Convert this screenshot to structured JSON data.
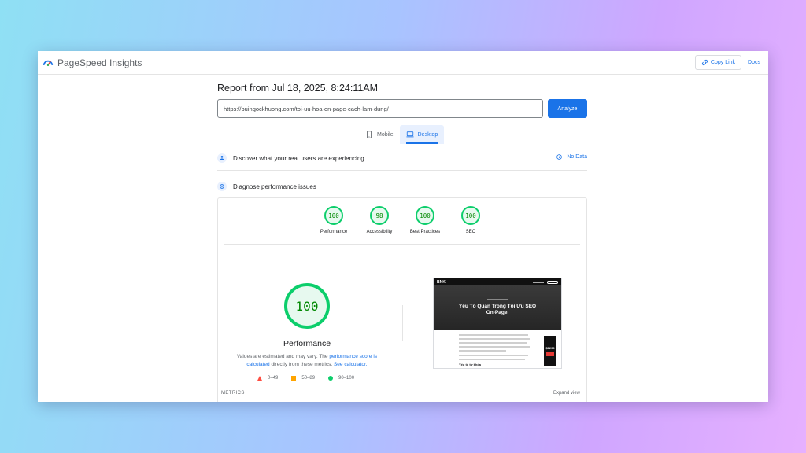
{
  "header": {
    "app_title": "PageSpeed Insights",
    "copy_link_label": "Copy Link",
    "docs_label": "Docs"
  },
  "report": {
    "title": "Report from Jul 18, 2025, 8:24:11AM",
    "url_value": "https://buingockhuong.com/toi-uu-hoa-on-page-cach-lam-dung/",
    "analyze_label": "Analyze"
  },
  "tabs": [
    {
      "label": "Mobile",
      "icon": "mobile-icon",
      "active": false
    },
    {
      "label": "Desktop",
      "icon": "desktop-icon",
      "active": true
    }
  ],
  "sections": {
    "real_users_label": "Discover what your real users are experiencing",
    "no_data_label": "No Data",
    "diagnose_label": "Diagnose performance issues"
  },
  "scores": [
    {
      "label": "Performance",
      "value": "100"
    },
    {
      "label": "Accessibility",
      "value": "98"
    },
    {
      "label": "Best Practices",
      "value": "100"
    },
    {
      "label": "SEO",
      "value": "100"
    }
  ],
  "performance": {
    "score": "100",
    "title": "Performance",
    "desc_prefix": "Values are estimated and may vary. The",
    "desc_link1": "performance score is calculated",
    "desc_mid": "directly from these metrics.",
    "desc_link2": "See calculator."
  },
  "legend": [
    {
      "range": "0–49",
      "shape": "triangle",
      "color": "#ff4e42"
    },
    {
      "range": "50–89",
      "shape": "square",
      "color": "#ffa400"
    },
    {
      "range": "90–100",
      "shape": "circle",
      "color": "#0cce6b"
    }
  ],
  "screenshot": {
    "logo": "BNK",
    "hero_title": "Yếu Tố Quan Trọng Tối Ưu SEO On-Page.",
    "subheading": "Yếu tố từ khóa",
    "ad_price": "$1299"
  },
  "metrics": {
    "label": "METRICS",
    "expand_label": "Expand view"
  },
  "colors": {
    "accent": "#1a73e8",
    "pass": "#0cce6b",
    "average": "#ffa400",
    "fail": "#ff4e42"
  }
}
